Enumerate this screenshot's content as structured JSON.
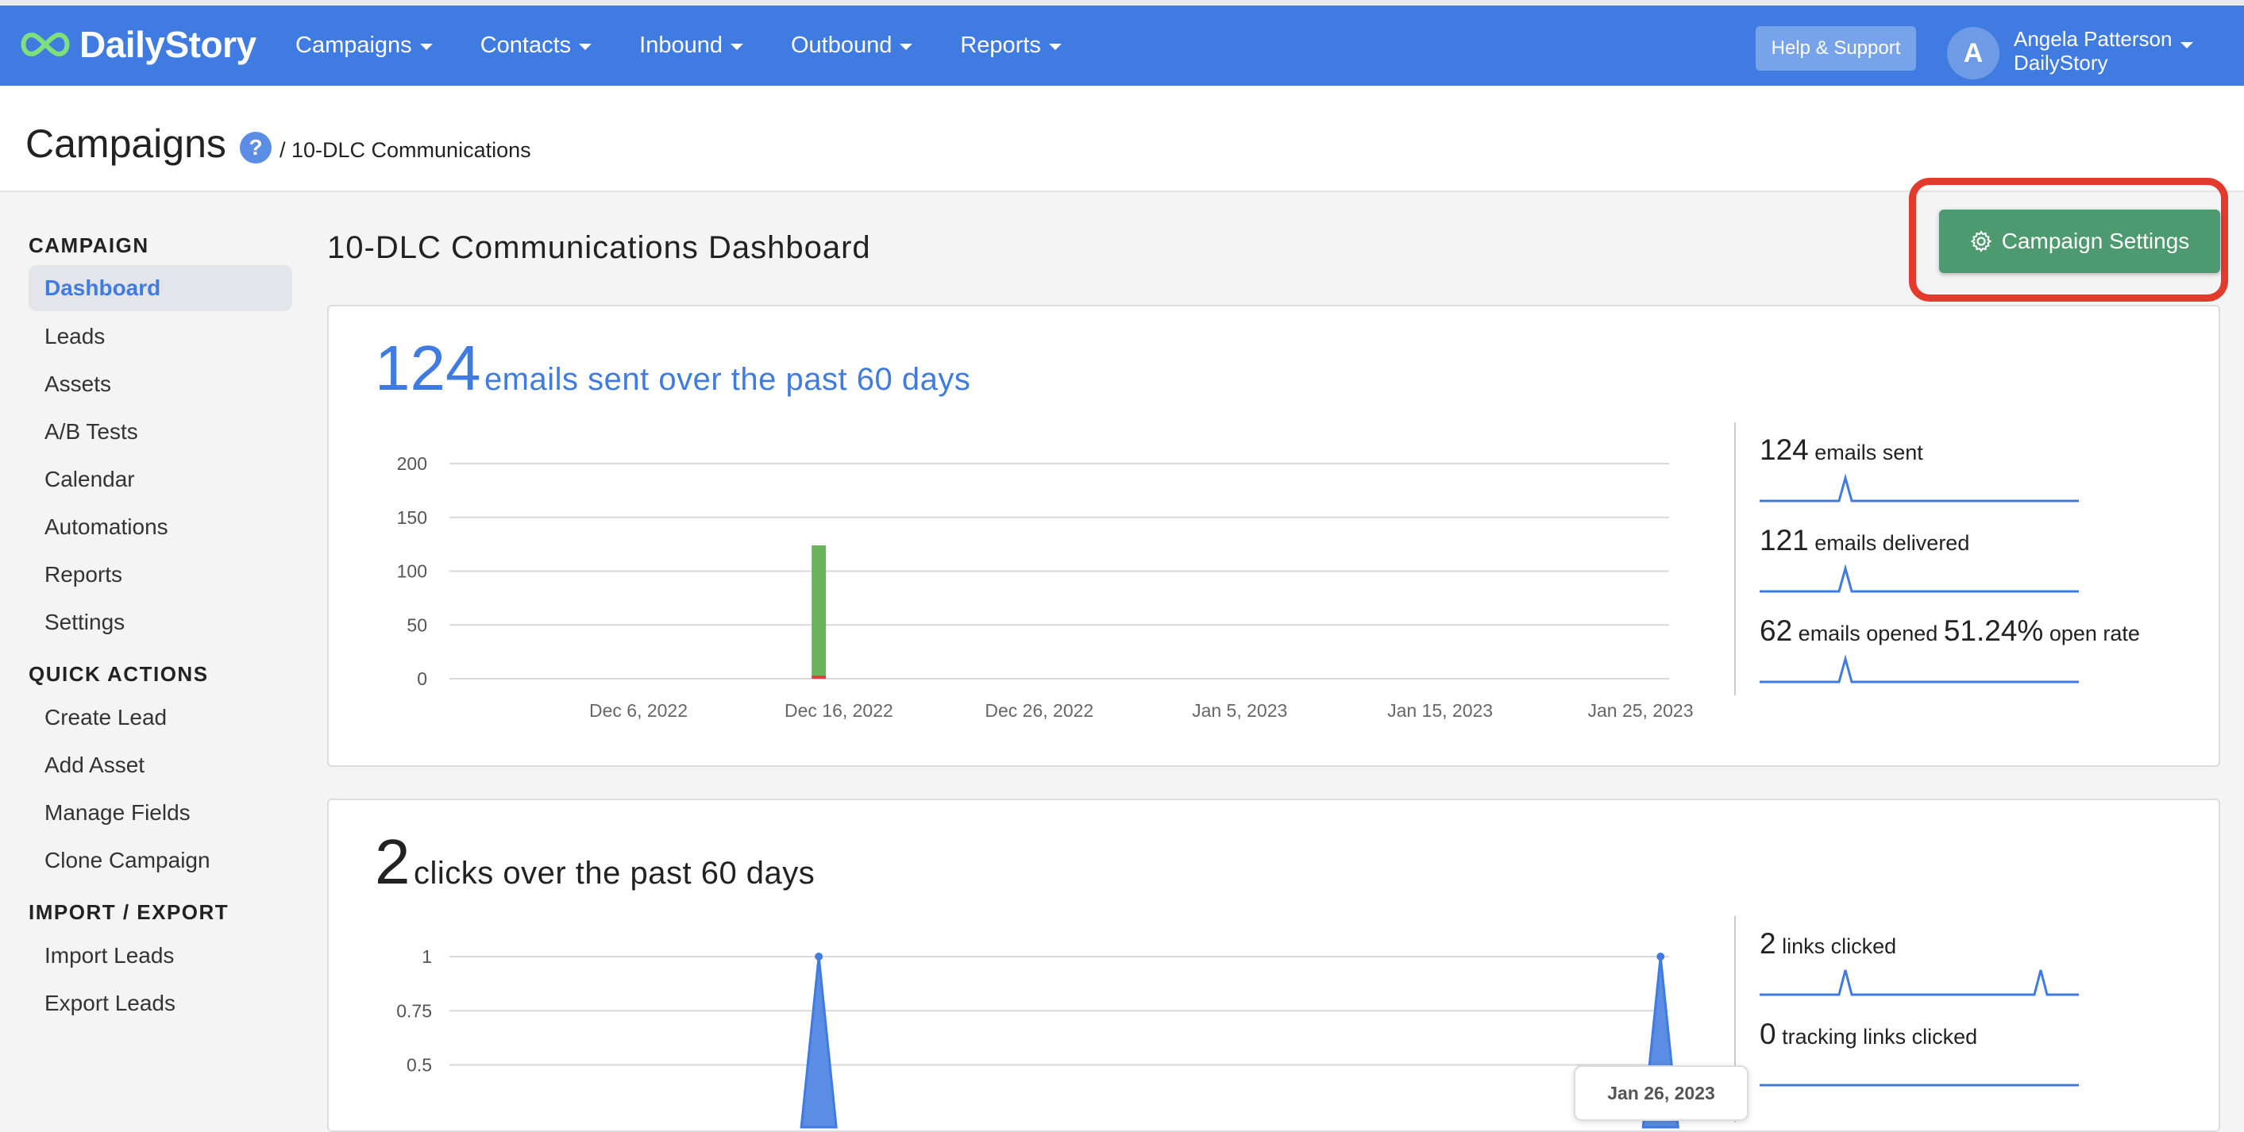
{
  "app": {
    "name": "DailyStory"
  },
  "nav": {
    "items": [
      {
        "label": "Campaigns"
      },
      {
        "label": "Contacts"
      },
      {
        "label": "Inbound"
      },
      {
        "label": "Outbound"
      },
      {
        "label": "Reports"
      }
    ],
    "help_label": "Help & Support",
    "user_initial": "A",
    "user_name": "Angela Patterson",
    "user_org": "DailyStory"
  },
  "header": {
    "title": "Campaigns",
    "help_glyph": "?",
    "breadcrumb": "/ 10-DLC Communications"
  },
  "sidebar": {
    "sections": [
      {
        "title": "CAMPAIGN",
        "items": [
          "Dashboard",
          "Leads",
          "Assets",
          "A/B Tests",
          "Calendar",
          "Automations",
          "Reports",
          "Settings"
        ]
      },
      {
        "title": "QUICK ACTIONS",
        "items": [
          "Create Lead",
          "Add Asset",
          "Manage Fields",
          "Clone Campaign"
        ]
      },
      {
        "title": "IMPORT / EXPORT",
        "items": [
          "Import Leads",
          "Export Leads"
        ]
      }
    ],
    "active": "Dashboard"
  },
  "main": {
    "title": "10-DLC Communications Dashboard",
    "settings_button": "Campaign Settings"
  },
  "emails_card": {
    "big_number": "124",
    "big_label": "emails sent over the past 60 days",
    "stats": [
      {
        "num": "124",
        "label": "emails sent"
      },
      {
        "num": "121",
        "label": "emails delivered"
      },
      {
        "num": "62",
        "label": "emails opened",
        "num2": "51.24%",
        "label2": "open rate"
      }
    ]
  },
  "clicks_card": {
    "big_number": "2",
    "big_label": "clicks over the past 60 days",
    "stats": [
      {
        "num": "2",
        "label": "links clicked"
      },
      {
        "num": "0",
        "label": "tracking links clicked"
      }
    ],
    "tooltip": "Jan 26, 2023"
  },
  "colors": {
    "accent": "#3f7be1",
    "delivered": "#69b35a",
    "bounced": "#d9463b",
    "settings": "#4e9a70",
    "highlight": "#e23b2e"
  },
  "chart_data": [
    {
      "type": "bar",
      "x": [
        "Dec 6, 2022",
        "Dec 16, 2022",
        "Dec 26, 2022",
        "Jan 5, 2023",
        "Jan 15, 2023",
        "Jan 25, 2023"
      ],
      "ylim": [
        0,
        200
      ],
      "yticks": [
        200,
        150,
        100,
        50,
        0
      ],
      "series": [
        {
          "color": "#69b35a",
          "points": [
            {
              "x": "Dec 15, 2022",
              "y": 121
            }
          ]
        },
        {
          "color": "#d9463b",
          "points": [
            {
              "x": "Dec 15, 2022",
              "y": 3
            }
          ]
        }
      ]
    },
    {
      "type": "area",
      "ylim": [
        0,
        1
      ],
      "yticks": [
        1,
        0.75,
        0.5
      ],
      "series": [
        {
          "color": "#3f7be1",
          "points": [
            {
              "x": "Dec 15, 2022",
              "y": 1
            },
            {
              "x": "Jan 26, 2023",
              "y": 1
            }
          ]
        }
      ]
    }
  ]
}
